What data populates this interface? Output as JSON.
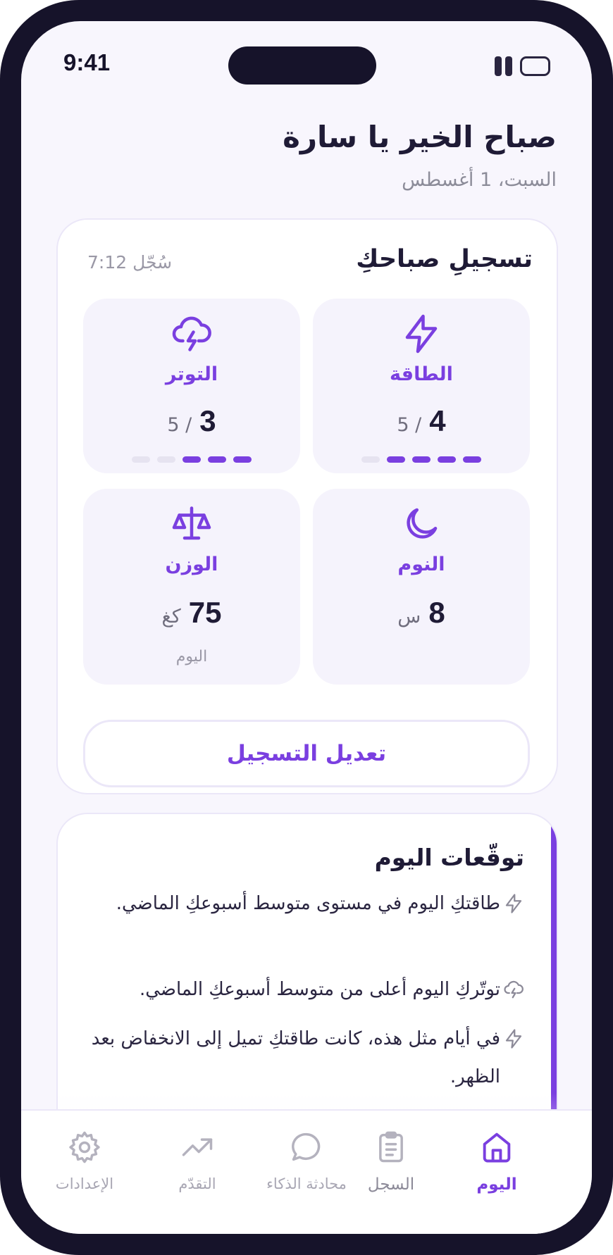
{
  "status_bar": {
    "time": "9:41"
  },
  "header": {
    "greeting": "صباح الخير يا سارة",
    "date": "السبت، 1 أغسطس"
  },
  "checkin": {
    "title": "تسجيلِ صباحكِ",
    "logged_time": "سُجّل 7:12",
    "tiles": {
      "energy": {
        "label": "الطاقة",
        "value": "4",
        "max": "/ 5",
        "level": 4,
        "icon": "lightning-icon"
      },
      "stress": {
        "label": "التوتر",
        "value": "3",
        "max": "/ 5",
        "level": 3,
        "icon": "storm-cloud-icon"
      },
      "sleep": {
        "label": "النوم",
        "value": "8",
        "unit": "س",
        "icon": "moon-icon"
      },
      "weight": {
        "label": "الوزن",
        "value": "75",
        "unit": "كغ",
        "note": "اليوم",
        "icon": "scale-icon"
      }
    },
    "edit_button": "تعديل التسجيل"
  },
  "forecast": {
    "title": "توقّعات اليوم",
    "items": [
      {
        "icon": "lightning-icon",
        "text": "طاقتكِ اليوم في مستوى متوسط أسبوعكِ الماضي."
      },
      {
        "icon": "storm-cloud-icon",
        "text": "توتّركِ اليوم أعلى من متوسط أسبوعكِ الماضي."
      },
      {
        "icon": "lightning-icon",
        "text": "في أيام مثل هذه، كانت طاقتكِ تميل إلى الانخفاض بعد الظهر."
      }
    ]
  },
  "nav": {
    "today": "اليوم",
    "log": "السجل",
    "ai_chat": "محادثة الذكاء",
    "progress": "التقدّم",
    "settings": "الإعدادات"
  },
  "colors": {
    "accent": "#7a3fe0",
    "frame": "#16132a",
    "background": "#f8f6fd"
  }
}
